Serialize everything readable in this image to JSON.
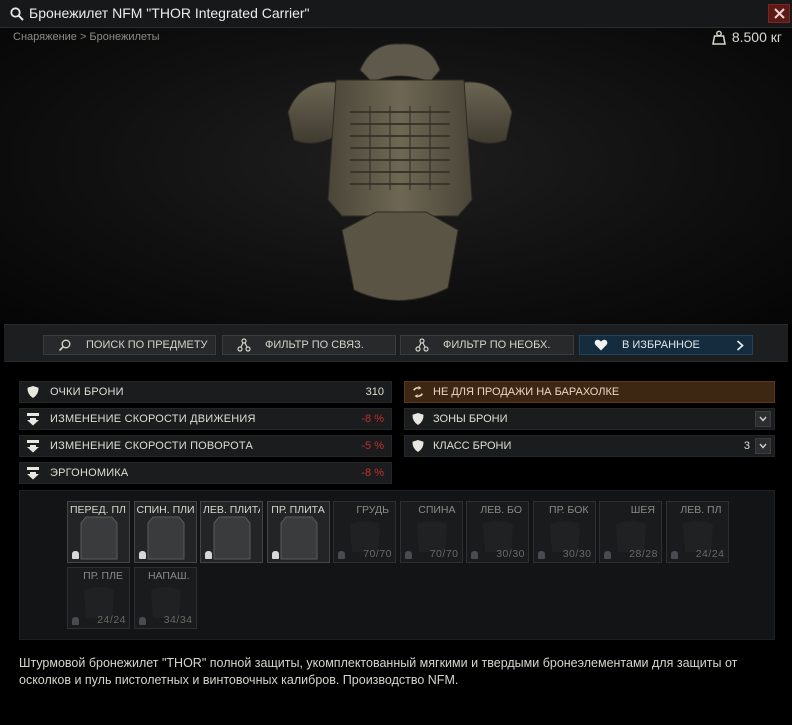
{
  "window": {
    "title": "Бронежилет NFM \"THOR Integrated Carrier\"",
    "breadcrumb": "Снаряжение > Бронежилеты",
    "weight": "8.500 кг",
    "colors": {
      "accent": "#152c3e",
      "negative": "#c0322b",
      "warning": "#3d2612",
      "close": "#5c1a17"
    }
  },
  "actions": [
    {
      "label": "ПОИСК ПО ПРЕДМЕТУ",
      "icon": "search-icon"
    },
    {
      "label": "ФИЛЬТР ПО СВЯЗ.",
      "icon": "link-filter-icon"
    },
    {
      "label": "ФИЛЬТР ПО НЕОБХ.",
      "icon": "required-filter-icon"
    },
    {
      "label": "В ИЗБРАННОЕ",
      "icon": "heart-icon"
    }
  ],
  "stats": [
    {
      "label": "ОЧКИ БРОНИ",
      "value": "310",
      "icon": "shield-icon"
    },
    {
      "label": "ИЗМЕНЕНИЕ СКОРОСТИ ДВИЖЕНИЯ",
      "value": "-8 %",
      "icon": "speed-down-icon"
    },
    {
      "label": "ИЗМЕНЕНИЕ СКОРОСТИ ПОВОРОТА",
      "value": "-5 %",
      "icon": "turn-down-icon"
    },
    {
      "label": "ЭРГОНОМИКА",
      "value": "-8 %",
      "icon": "ergonomics-down-icon"
    }
  ],
  "info": {
    "not_for_flea": "НЕ ДЛЯ ПРОДАЖИ НА БАРАХОЛКЕ",
    "armor_zones": "ЗОНЫ БРОНИ",
    "armor_class_label": "КЛАСС БРОНИ",
    "armor_class_value": "3"
  },
  "slots": [
    {
      "name": "ПЕРЕД. ПЛ...",
      "filled": true,
      "durability": ""
    },
    {
      "name": "СПИН. ПЛИ...",
      "filled": true,
      "durability": ""
    },
    {
      "name": "ЛЕВ. ПЛИТА",
      "filled": true,
      "durability": ""
    },
    {
      "name": "ПР. ПЛИТА",
      "filled": true,
      "durability": ""
    },
    {
      "name": "ГРУДЬ",
      "filled": false,
      "durability": "70/70"
    },
    {
      "name": "СПИНА",
      "filled": false,
      "durability": "70/70"
    },
    {
      "name": "ЛЕВ. БО",
      "filled": false,
      "durability": "30/30"
    },
    {
      "name": "ПР. БОК",
      "filled": false,
      "durability": "30/30"
    },
    {
      "name": "ШЕЯ",
      "filled": false,
      "durability": "28/28"
    },
    {
      "name": "ЛЕВ. ПЛ",
      "filled": false,
      "durability": "24/24"
    },
    {
      "name": "ПР. ПЛЕ",
      "filled": false,
      "durability": "24/24"
    },
    {
      "name": "НАПАШ.",
      "filled": false,
      "durability": "34/34"
    }
  ],
  "description": "Штурмовой бронежилет \"THOR\" полной защиты, укомплектованный мягкими и твердыми бронеэлементами для защиты от осколков и пуль пистолетных и винтовочных калибров. Производство NFM."
}
